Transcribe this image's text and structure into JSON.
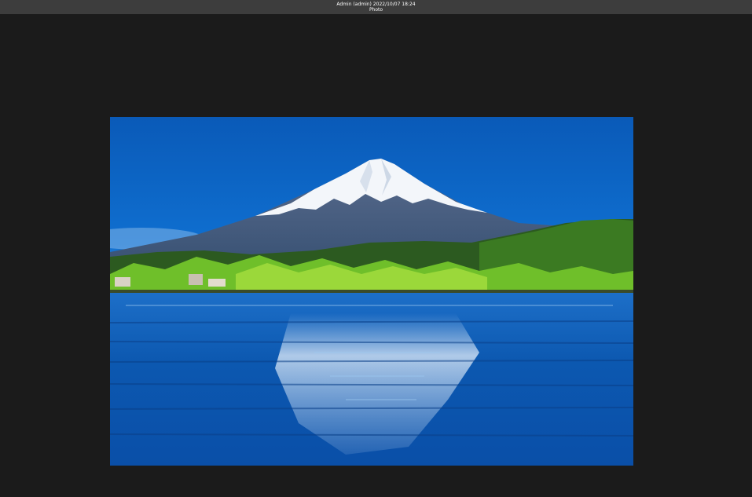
{
  "titlebar": {
    "title": "Admin (admin) 2022/10/07 18:24",
    "subtitle": "Photo"
  },
  "viewer": {
    "image_icon": "photo-image"
  },
  "colors": {
    "background": "#1b1b1b",
    "titlebar": "#3d3d3d",
    "sky": "#0a5fbf",
    "water": "#0b4fa3",
    "snow": "#f2f4f7",
    "forest": "#2f6b1e"
  }
}
